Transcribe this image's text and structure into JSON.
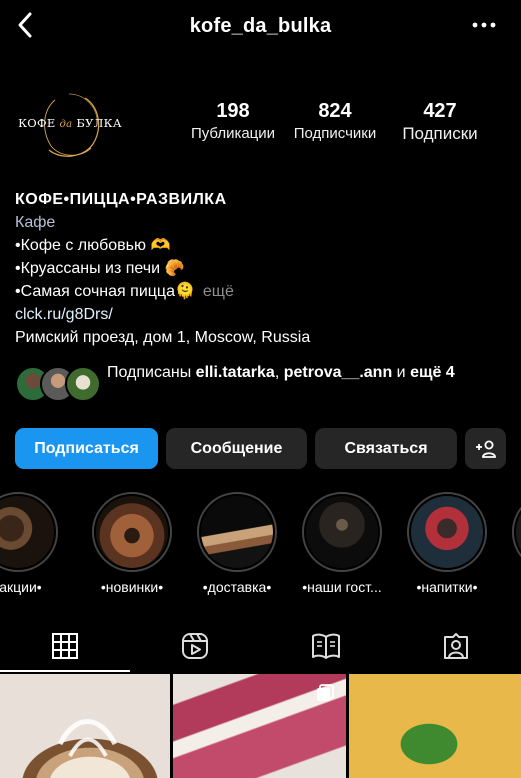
{
  "header": {
    "username": "kofe_da_bulka",
    "back_icon": "chevron-left-icon",
    "more_icon": "ellipsis-icon"
  },
  "profile": {
    "logo_left": "КОФЕ",
    "logo_mid": "да",
    "logo_right": "БУЛКА",
    "stats": [
      {
        "value": "198",
        "label": "Публикации"
      },
      {
        "value": "824",
        "label": "Подписчики"
      },
      {
        "value": "427",
        "label": "Подписки"
      }
    ]
  },
  "bio": {
    "name": "КОФЕ•ПИЦЦА•РАЗВИЛКА",
    "category": "Кафе",
    "lines": [
      "•Кофе с любовью 🫶",
      "•Круассаны из печи 🥐",
      "•Самая сочная пицца🫠"
    ],
    "more": "ещё",
    "link": "clck.ru/g8Drs/",
    "address": "Римский проезд, дом 1, Moscow, Russia"
  },
  "followers": {
    "prefix": "Подписаны",
    "user1": "elli.tatarka",
    "separator": ",",
    "user2": "petrova__.ann",
    "conj": "и",
    "suffix": "ещё 4"
  },
  "buttons": {
    "follow": "Подписаться",
    "message": "Сообщение",
    "contact": "Связаться",
    "add_user_icon": "add-user-icon"
  },
  "highlights": [
    {
      "label": "•акции•"
    },
    {
      "label": "•новинки•"
    },
    {
      "label": "•доставка•"
    },
    {
      "label": "•наши гост..."
    },
    {
      "label": "•напитки•"
    }
  ],
  "tabs": [
    {
      "icon": "grid-icon",
      "active": true
    },
    {
      "icon": "reels-icon",
      "active": false
    },
    {
      "icon": "guide-icon",
      "active": false
    },
    {
      "icon": "tagged-icon",
      "active": false
    }
  ],
  "colors": {
    "background": "#000000",
    "primary_button": "#1a96f0",
    "secondary_button": "#262626",
    "logo_accent": "#d9a84e"
  }
}
